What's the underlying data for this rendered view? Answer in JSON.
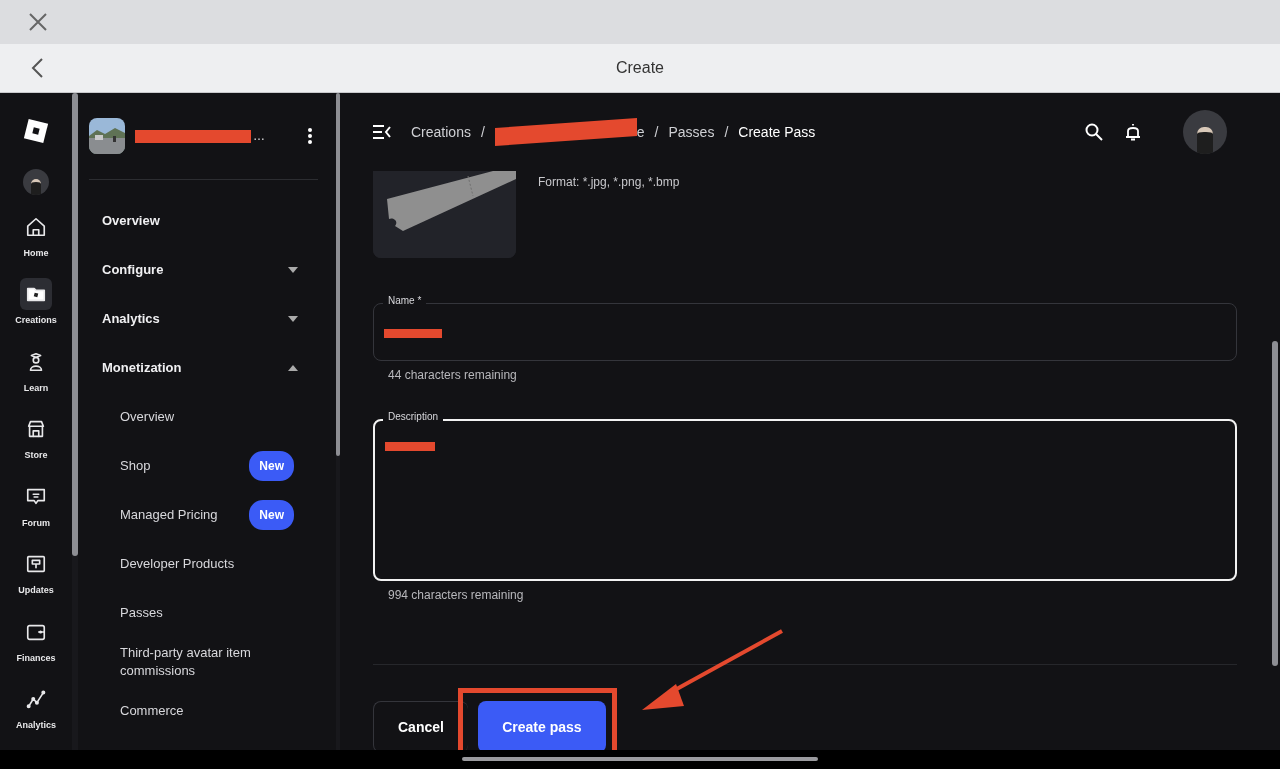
{
  "window": {
    "title": "Create"
  },
  "rail": {
    "items": [
      {
        "label": "Home",
        "selected": false
      },
      {
        "label": "Creations",
        "selected": true
      },
      {
        "label": "Learn",
        "selected": false
      },
      {
        "label": "Store",
        "selected": false
      },
      {
        "label": "Forum",
        "selected": false
      },
      {
        "label": "Updates",
        "selected": false
      },
      {
        "label": "Finances",
        "selected": false
      },
      {
        "label": "Analytics",
        "selected": false
      }
    ]
  },
  "sidebar": {
    "experience": {
      "title": "…",
      "redacted": true
    },
    "nav": [
      {
        "label": "Overview",
        "kind": "link"
      },
      {
        "label": "Configure",
        "kind": "section",
        "expanded": false
      },
      {
        "label": "Analytics",
        "kind": "section",
        "expanded": false
      },
      {
        "label": "Monetization",
        "kind": "section",
        "expanded": true,
        "children": [
          {
            "label": "Overview"
          },
          {
            "label": "Shop",
            "badge": "New"
          },
          {
            "label": "Managed Pricing",
            "badge": "New"
          },
          {
            "label": "Developer Products"
          },
          {
            "label": "Passes"
          },
          {
            "label": "Third-party avatar item commissions"
          },
          {
            "label": "Commerce"
          }
        ]
      }
    ]
  },
  "breadcrumb": [
    {
      "label": "Creations",
      "redacted": false
    },
    {
      "separator": "/",
      "label": "e",
      "redacted": true
    },
    {
      "separator": "/",
      "label": "Passes",
      "redacted": false
    },
    {
      "separator": "/",
      "label": "Create Pass",
      "redacted": false
    }
  ],
  "image": {
    "format": "Format: *.jpg, *.png, *.bmp"
  },
  "fields": [
    {
      "label": "Name *",
      "redacted": true,
      "focused": false,
      "kind": "input",
      "helper": "44 characters remaining"
    },
    {
      "label": "Description",
      "redacted": true,
      "focused": true,
      "kind": "textarea",
      "helper": "994 characters remaining"
    }
  ],
  "buttons": [
    {
      "label": "Cancel",
      "kind": "outlined",
      "highlighted": false
    },
    {
      "label": "Create pass",
      "kind": "primary",
      "highlighted": true
    }
  ]
}
